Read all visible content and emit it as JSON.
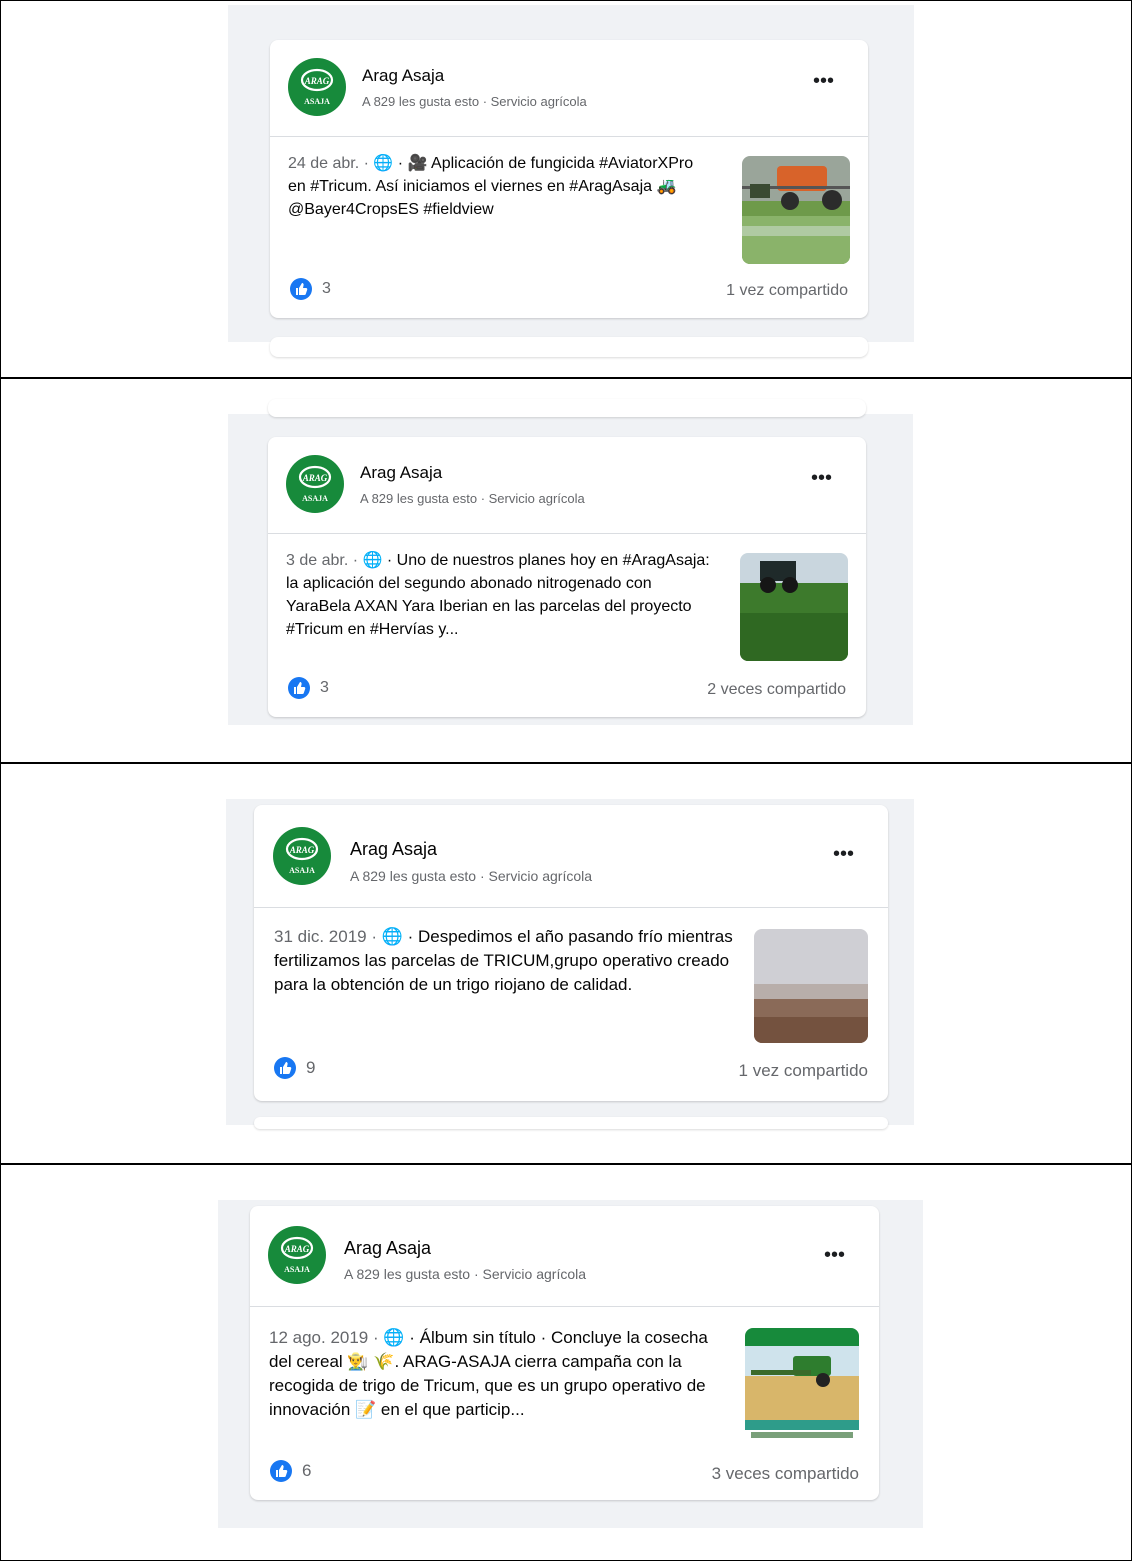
{
  "posts": [
    {
      "page_name": "Arag Asaja",
      "subtitle": "A 829 les gusta esto · Servicio agrícola",
      "date": "24 de abr. · ",
      "text": " · 🎥 Aplicación de fungicida #AviatorXPro en #Tricum. Así iniciamos el viernes en #AragAsaja 🚜 @Bayer4CropsES #fieldview",
      "likes": "3",
      "shares": "1 vez compartido",
      "more_label": "•••"
    },
    {
      "page_name": "Arag Asaja",
      "subtitle": "A 829 les gusta esto · Servicio agrícola",
      "date": "3 de abr. · ",
      "text": " · Uno de nuestros planes hoy en #AragAsaja: la aplicación del segundo abonado nitrogenado con YaraBela AXAN Yara Iberian en las parcelas del proyecto #Tricum en #Hervías y...",
      "likes": "3",
      "shares": "2 veces compartido",
      "more_label": "•••"
    },
    {
      "page_name": "Arag Asaja",
      "subtitle": "A 829 les gusta esto · Servicio agrícola",
      "date": "31 dic. 2019 · ",
      "text": " · Despedimos el año pasando frío mientras fertilizamos las parcelas de TRICUM,grupo operativo creado para la obtención de un trigo riojano de calidad.",
      "likes": "9",
      "shares": "1 vez compartido",
      "more_label": "•••"
    },
    {
      "page_name": "Arag Asaja",
      "subtitle": "A 829 les gusta esto · Servicio agrícola",
      "date": "12 ago. 2019 · ",
      "text": " · Álbum sin título · Concluye la cosecha del cereal 👨‍🌾 🌾. ARAG-ASAJA cierra campaña con la recogida de trigo de Tricum, que es un grupo operativo de innovación 📝 en el que particip...",
      "likes": "6",
      "shares": "3 veces compartido",
      "more_label": "•••"
    }
  ],
  "avatar_text": {
    "top": "ARAG",
    "bottom": "ASAJA"
  },
  "colors": {
    "brand_green": "#178a3b",
    "like_blue": "#1877f2",
    "panel_bg": "#f0f2f5"
  }
}
